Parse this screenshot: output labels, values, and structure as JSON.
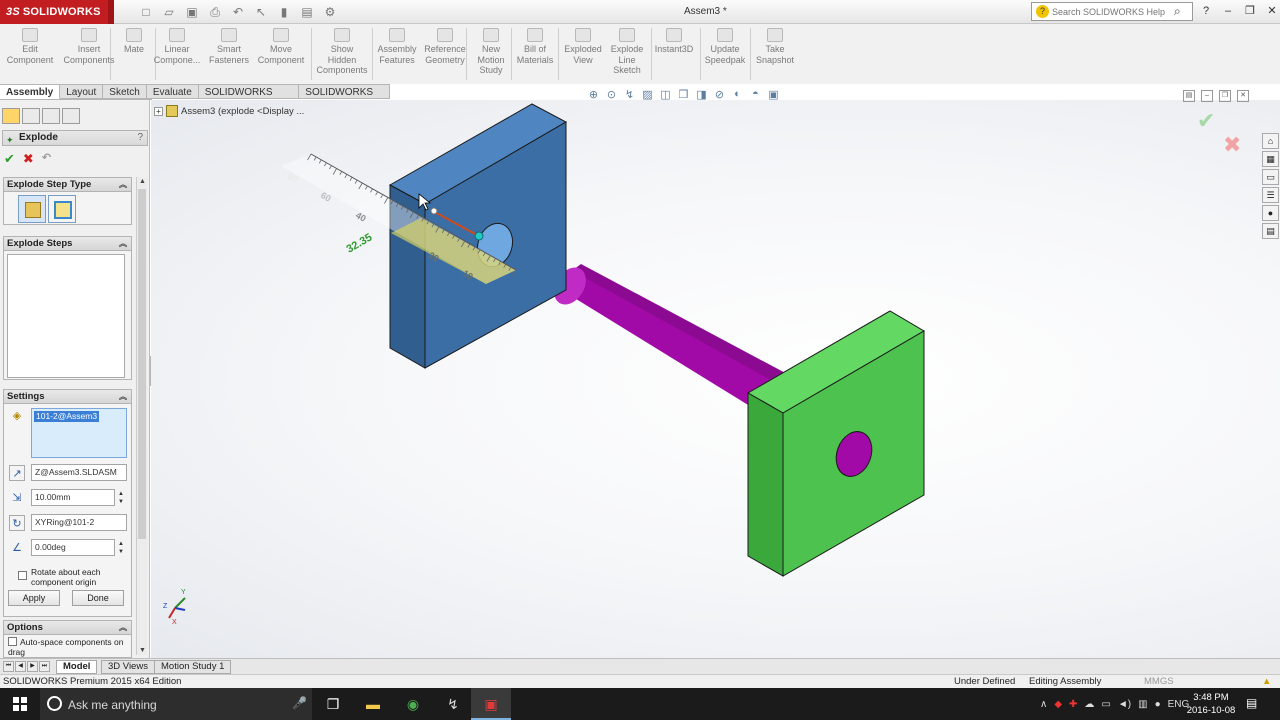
{
  "app": {
    "logo_text": "SOLIDWORKS",
    "logo_prefix": "3S",
    "doc_title": "Assem3 *"
  },
  "search": {
    "placeholder": "Search SOLIDWORKS Help"
  },
  "ribbon": [
    {
      "label": "Edit\nComponent"
    },
    {
      "label": "Insert\nComponents"
    },
    {
      "label": "Mate"
    },
    {
      "label": "Linear\nCompone..."
    },
    {
      "label": "Smart\nFasteners"
    },
    {
      "label": "Move\nComponent"
    },
    {
      "label": "Show\nHidden\nComponents"
    },
    {
      "label": "Assembly\nFeatures"
    },
    {
      "label": "Reference\nGeometry"
    },
    {
      "label": "New\nMotion\nStudy"
    },
    {
      "label": "Bill of\nMaterials"
    },
    {
      "label": "Exploded\nView"
    },
    {
      "label": "Explode\nLine\nSketch"
    },
    {
      "label": "Instant3D"
    },
    {
      "label": "Update\nSpeedpak"
    },
    {
      "label": "Take\nSnapshot"
    }
  ],
  "tabs": [
    "Assembly",
    "Layout",
    "Sketch",
    "Evaluate",
    "SOLIDWORKS Add-Ins",
    "SOLIDWORKS MBD"
  ],
  "property_manager": {
    "title": "Explode",
    "help": "?",
    "explode_step_type": "Explode Step Type",
    "explode_steps": "Explode Steps",
    "settings": {
      "header": "Settings",
      "selection": "101-2@Assem3",
      "direction": "Z@Assem3.SLDASM",
      "distance": "10.00mm",
      "rotation_axis": "XYRing@101-2",
      "angle": "0.00deg",
      "rotate_origin": "Rotate about each component origin",
      "apply": "Apply",
      "done": "Done"
    },
    "options": {
      "header": "Options",
      "auto_space": "Auto-space components on drag"
    }
  },
  "tree": {
    "label": "Assem3  (explode <Display ..."
  },
  "ruler": {
    "labels": [
      "80",
      "60",
      "40",
      "20",
      "10"
    ],
    "readout": "32.35"
  },
  "bottom_tabs": [
    "Model",
    "3D Views",
    "Motion Study 1"
  ],
  "status": {
    "left": "SOLIDWORKS Premium 2015 x64 Edition",
    "center": "Under Defined",
    "right": "Editing Assembly",
    "units": "MMGS"
  },
  "taskbar": {
    "search_text": "Ask me anything",
    "lang": "ENG",
    "time": "3:48 PM",
    "date": "2016-10-08"
  },
  "colors": {
    "block_blue": "#3b6ea5",
    "rod_magenta": "#a20aa7",
    "block_green": "#4ec24e"
  }
}
